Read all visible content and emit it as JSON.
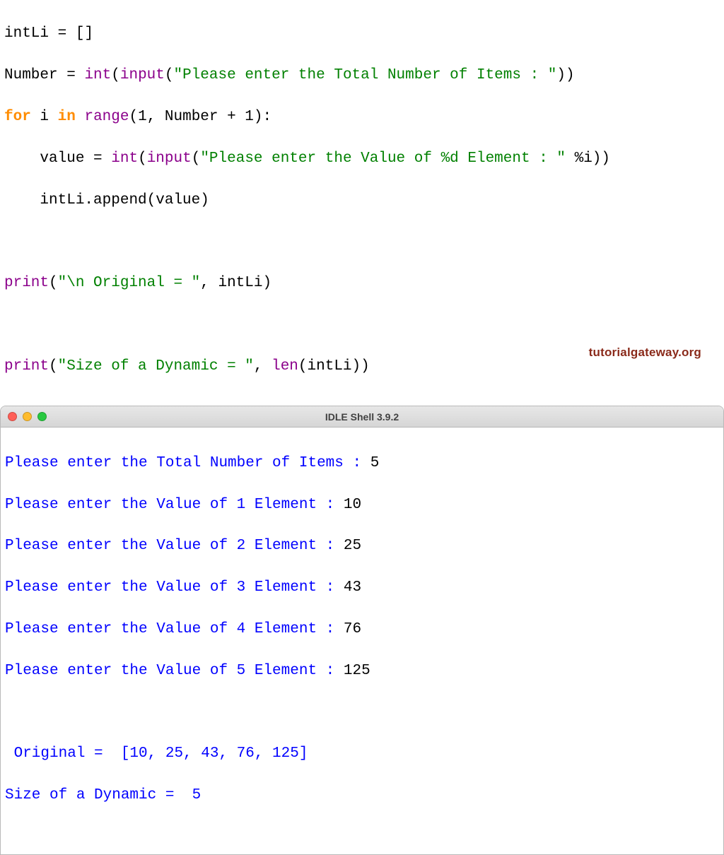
{
  "editor": {
    "line1": {
      "lhs": "intLi",
      "op": "=",
      "rhs": "[]"
    },
    "line2": {
      "lhs": "Number",
      "op": "=",
      "fn1": "int",
      "fn2": "input",
      "str": "\"Please enter the Total Number of Items : \"",
      "close": "))"
    },
    "line3": {
      "kw1": "for",
      "var": "i",
      "kw2": "in",
      "fn": "range",
      "args": "(1, Number + 1):"
    },
    "line4": {
      "indent": "    ",
      "lhs": "value",
      "op": "=",
      "fn1": "int",
      "fn2": "input",
      "str": "\"Please enter the Value of %d Element : \"",
      "tail": " %i))"
    },
    "line5": {
      "indent": "    ",
      "call": "intLi.append(value)"
    },
    "line7": {
      "fn": "print",
      "open": "(",
      "str": "\"\\n Original = \"",
      "rest": ", intLi)"
    },
    "line9": {
      "fn": "print",
      "open": "(",
      "str": "\"Size of a Dynamic = \"",
      "mid": ", ",
      "fn2": "len",
      "rest2": "(intLi))"
    }
  },
  "shell": {
    "title": "IDLE Shell 3.9.2",
    "lines": [
      {
        "prompt": "Please enter the Total Number of Items : ",
        "input": "5"
      },
      {
        "prompt": "Please enter the Value of 1 Element : ",
        "input": "10"
      },
      {
        "prompt": "Please enter the Value of 2 Element : ",
        "input": "25"
      },
      {
        "prompt": "Please enter the Value of 3 Element : ",
        "input": "43"
      },
      {
        "prompt": "Please enter the Value of 4 Element : ",
        "input": "76"
      },
      {
        "prompt": "Please enter the Value of 5 Element : ",
        "input": "125"
      }
    ],
    "blank": "",
    "result1": " Original =  [10, 25, 43, 76, 125]",
    "result2": "Size of a Dynamic =  5"
  },
  "watermark": "tutorialgateway.org"
}
